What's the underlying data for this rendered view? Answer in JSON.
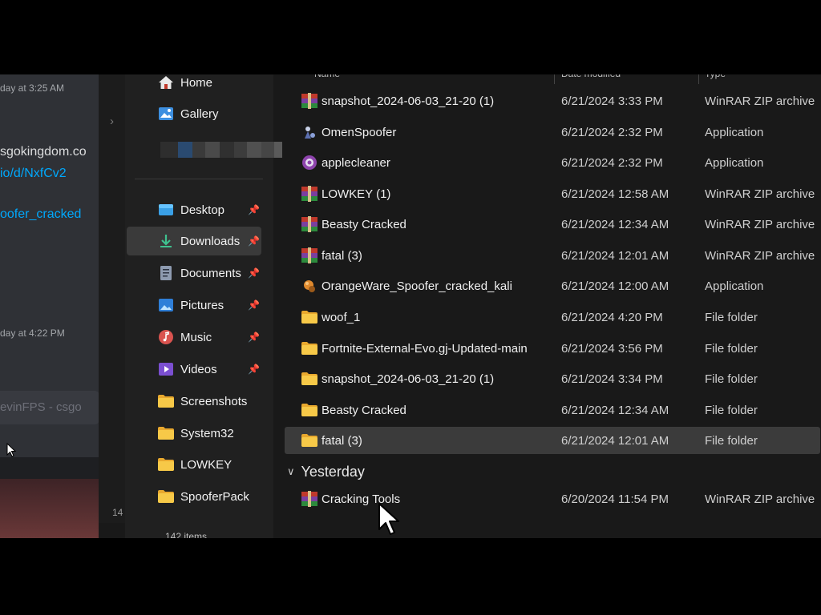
{
  "chat": {
    "timestamp_1": "day at 3:25 AM",
    "link_1": "sgokingdom.co",
    "link_2": "io/d/NxfCv2",
    "link_3": "oofer_cracked",
    "timestamp_2": "day at 4:22 PM",
    "input_placeholder": "evinFPS - csgo"
  },
  "explorer": {
    "status_count": "14",
    "status_items": "142 items",
    "nav": {
      "items": [
        {
          "label": "Home",
          "icon": "home-icon"
        },
        {
          "label": "Gallery",
          "icon": "gallery-icon"
        },
        {
          "label": "Desktop",
          "icon": "desktop-icon",
          "pinned": true
        },
        {
          "label": "Downloads",
          "icon": "downloads-icon",
          "pinned": true,
          "selected": true
        },
        {
          "label": "Documents",
          "icon": "documents-icon",
          "pinned": true
        },
        {
          "label": "Pictures",
          "icon": "pictures-icon",
          "pinned": true
        },
        {
          "label": "Music",
          "icon": "music-icon",
          "pinned": true
        },
        {
          "label": "Videos",
          "icon": "videos-icon",
          "pinned": true
        },
        {
          "label": "Screenshots",
          "icon": "folder-icon"
        },
        {
          "label": "System32",
          "icon": "folder-icon"
        },
        {
          "label": "LOWKEY",
          "icon": "folder-icon"
        },
        {
          "label": "SpooferPack",
          "icon": "folder-icon"
        }
      ]
    },
    "columns": {
      "name": "Name",
      "date": "Date modified",
      "type": "Type"
    },
    "files": [
      {
        "name": "snapshot_2024-06-03_21-20 (1)",
        "date": "6/21/2024 3:33 PM",
        "type": "WinRAR ZIP archive",
        "icon": "winrar-icon"
      },
      {
        "name": "OmenSpoofer",
        "date": "6/21/2024 2:32 PM",
        "type": "Application",
        "icon": "app-icon"
      },
      {
        "name": "applecleaner",
        "date": "6/21/2024 2:32 PM",
        "type": "Application",
        "icon": "app-icon"
      },
      {
        "name": "LOWKEY (1)",
        "date": "6/21/2024 12:58 AM",
        "type": "WinRAR ZIP archive",
        "icon": "winrar-icon"
      },
      {
        "name": "Beasty Cracked",
        "date": "6/21/2024 12:34 AM",
        "type": "WinRAR ZIP archive",
        "icon": "winrar-icon"
      },
      {
        "name": "fatal (3)",
        "date": "6/21/2024 12:01 AM",
        "type": "WinRAR ZIP archive",
        "icon": "winrar-icon"
      },
      {
        "name": "OrangeWare_Spoofer_cracked_kali",
        "date": "6/21/2024 12:00 AM",
        "type": "Application",
        "icon": "app-icon"
      },
      {
        "name": "woof_1",
        "date": "6/21/2024 4:20 PM",
        "type": "File folder",
        "icon": "folder-icon"
      },
      {
        "name": "Fortnite-External-Evo.gj-Updated-main",
        "date": "6/21/2024 3:56 PM",
        "type": "File folder",
        "icon": "folder-icon"
      },
      {
        "name": "snapshot_2024-06-03_21-20 (1)",
        "date": "6/21/2024 3:34 PM",
        "type": "File folder",
        "icon": "folder-icon"
      },
      {
        "name": "Beasty Cracked",
        "date": "6/21/2024 12:34 AM",
        "type": "File folder",
        "icon": "folder-icon"
      },
      {
        "name": "fatal (3)",
        "date": "6/21/2024 12:01 AM",
        "type": "File folder",
        "icon": "folder-icon",
        "selected": true
      }
    ],
    "group_yesterday": {
      "label": "Yesterday",
      "files": [
        {
          "name": "Cracking Tools",
          "date": "6/20/2024 11:54 PM",
          "type": "WinRAR ZIP archive",
          "icon": "winrar-icon"
        }
      ]
    }
  }
}
